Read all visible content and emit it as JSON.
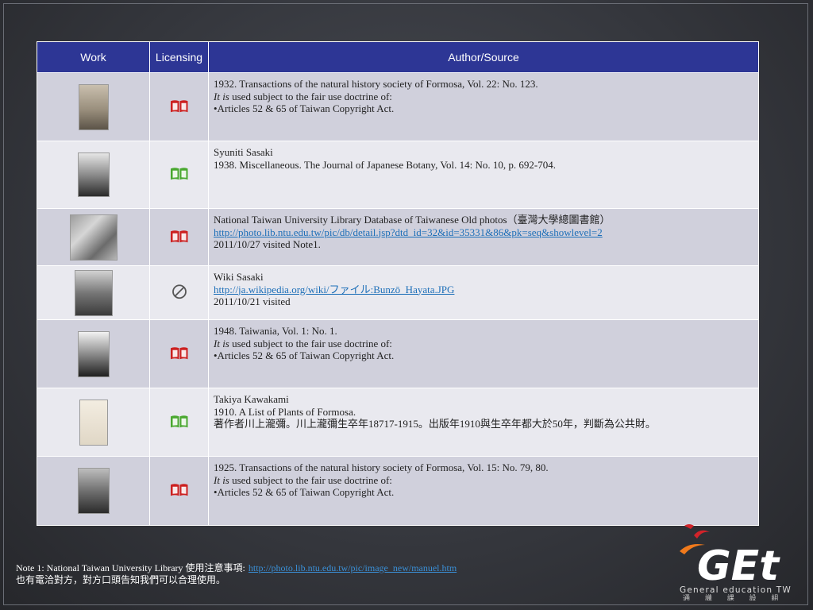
{
  "table": {
    "headers": {
      "work": "Work",
      "licensing": "Licensing",
      "source": "Author/Source"
    },
    "rows": [
      {
        "license_icon": "red-book-icon",
        "lines": [
          "1932. Transactions of the natural history society of Formosa, Vol. 22: No. 123.",
          {
            "italic": "It is",
            "rest": " used subject to the fair use doctrine of:"
          },
          "•Articles 52 & 65 of Taiwan Copyright Act."
        ]
      },
      {
        "license_icon": "green-book-icon",
        "lines": [
          "Syuniti Sasaki",
          "1938. Miscellaneous. The Journal of Japanese Botany, Vol. 14: No. 10, p. 692-704."
        ]
      },
      {
        "license_icon": "red-book-icon",
        "lines": [
          "National Taiwan University Library Database of Taiwanese Old photos（臺灣大學總圖書館）",
          {
            "link": "http://photo.lib.ntu.edu.tw/pic/db/detail.jsp?dtd_id=32&id=35331&86&pk=seq&showlevel=2"
          },
          "2011/10/27 visited Note1."
        ]
      },
      {
        "license_icon": "public-domain-icon",
        "lines": [
          "Wiki Sasaki",
          {
            "link": "http://ja.wikipedia.org/wiki/ファイル:Bunzō_Hayata.JPG"
          },
          "2011/10/21 visited"
        ]
      },
      {
        "license_icon": "red-book-icon",
        "lines": [
          "1948. Taiwania, Vol. 1: No. 1.",
          {
            "italic": "It is",
            "rest": " used subject to the fair use doctrine of:"
          },
          "•Articles 52 & 65 of Taiwan Copyright Act."
        ]
      },
      {
        "license_icon": "green-book-icon",
        "lines": [
          "Takiya Kawakami",
          "1910. A List of Plants of Formosa.",
          "著作者川上瀧彌。川上瀧彌生卒年18717-1915。出版年1910與生卒年都大於50年，判斷為公共財。"
        ]
      },
      {
        "license_icon": "red-book-icon",
        "lines": [
          "1925. Transactions of the natural history society of Formosa, Vol. 15: No. 79, 80.",
          {
            "italic": "It is",
            "rest": " used subject to the fair use doctrine of:"
          },
          "•Articles 52 & 65 of Taiwan Copyright Act."
        ]
      }
    ]
  },
  "note": {
    "line1": "Note 1: National Taiwan University Library 使用注意事項:",
    "link": "http://photo.lib.ntu.edu.tw/pic/image_new/manuel.htm",
    "line2": "也有電洽對方，對方口頭告知我們可以合理使用。"
  },
  "logo": {
    "wordmark": "GEt",
    "tagline": "General education TW",
    "chinese": "通 識 課 設 組"
  },
  "colors": {
    "header": "#2d3695",
    "row_odd": "#d0d0dc",
    "row_even": "#e9e9ef",
    "book_red": "#cc2020",
    "book_green": "#49a82f",
    "link": "#1d6fb8",
    "logo_orange": "#f07a1c",
    "logo_red": "#d2232a"
  }
}
